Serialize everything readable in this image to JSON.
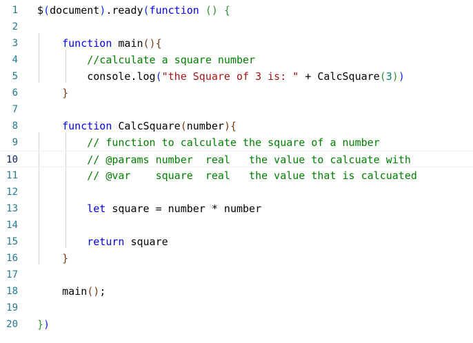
{
  "editor": {
    "current_line": 10,
    "lines": [
      {
        "n": "1",
        "tokens": [
          {
            "t": "$",
            "c": "tx"
          },
          {
            "t": "(",
            "c": "br1"
          },
          {
            "t": "document",
            "c": "tx"
          },
          {
            "t": ")",
            "c": "br1"
          },
          {
            "t": ".ready",
            "c": "tx"
          },
          {
            "t": "(",
            "c": "br1"
          },
          {
            "t": "function",
            "c": "kw"
          },
          {
            "t": " ",
            "c": "tx"
          },
          {
            "t": "()",
            "c": "br2"
          },
          {
            "t": " ",
            "c": "tx"
          },
          {
            "t": "{",
            "c": "br2"
          }
        ]
      },
      {
        "n": "2",
        "tokens": []
      },
      {
        "n": "3",
        "tokens": [
          {
            "t": "    ",
            "c": "tx"
          },
          {
            "t": "function",
            "c": "kw"
          },
          {
            "t": " main",
            "c": "tx"
          },
          {
            "t": "()",
            "c": "br3"
          },
          {
            "t": "{",
            "c": "br3"
          }
        ]
      },
      {
        "n": "4",
        "tokens": [
          {
            "t": "        ",
            "c": "tx"
          },
          {
            "t": "//calculate a square number",
            "c": "cm"
          }
        ]
      },
      {
        "n": "5",
        "tokens": [
          {
            "t": "        console.log",
            "c": "tx"
          },
          {
            "t": "(",
            "c": "br1"
          },
          {
            "t": "\"the Square of 3 is: \"",
            "c": "st"
          },
          {
            "t": " + CalcSquare",
            "c": "tx"
          },
          {
            "t": "(",
            "c": "br2"
          },
          {
            "t": "3",
            "c": "nm"
          },
          {
            "t": ")",
            "c": "br2"
          },
          {
            "t": ")",
            "c": "br1"
          }
        ]
      },
      {
        "n": "6",
        "tokens": [
          {
            "t": "    ",
            "c": "tx"
          },
          {
            "t": "}",
            "c": "br3"
          }
        ]
      },
      {
        "n": "7",
        "tokens": []
      },
      {
        "n": "8",
        "tokens": [
          {
            "t": "    ",
            "c": "tx"
          },
          {
            "t": "function",
            "c": "kw"
          },
          {
            "t": " CalcSquare",
            "c": "tx"
          },
          {
            "t": "(",
            "c": "br3"
          },
          {
            "t": "number",
            "c": "tx"
          },
          {
            "t": ")",
            "c": "br3"
          },
          {
            "t": "{",
            "c": "br3"
          }
        ]
      },
      {
        "n": "9",
        "tokens": [
          {
            "t": "        ",
            "c": "tx"
          },
          {
            "t": "// function to calculate the square of a number",
            "c": "cm"
          }
        ]
      },
      {
        "n": "10",
        "tokens": [
          {
            "t": "        ",
            "c": "tx"
          },
          {
            "t": "// @params number  real   the value to calcuate with",
            "c": "cm"
          }
        ]
      },
      {
        "n": "11",
        "tokens": [
          {
            "t": "        ",
            "c": "tx"
          },
          {
            "t": "// @var    square  real   the value that is calcuated",
            "c": "cm"
          }
        ]
      },
      {
        "n": "12",
        "tokens": []
      },
      {
        "n": "13",
        "tokens": [
          {
            "t": "        ",
            "c": "tx"
          },
          {
            "t": "let",
            "c": "kw"
          },
          {
            "t": " square = number * number",
            "c": "tx"
          }
        ]
      },
      {
        "n": "14",
        "tokens": []
      },
      {
        "n": "15",
        "tokens": [
          {
            "t": "        ",
            "c": "tx"
          },
          {
            "t": "return",
            "c": "kw"
          },
          {
            "t": " square",
            "c": "tx"
          }
        ]
      },
      {
        "n": "16",
        "tokens": [
          {
            "t": "    ",
            "c": "tx"
          },
          {
            "t": "}",
            "c": "br3"
          }
        ]
      },
      {
        "n": "17",
        "tokens": []
      },
      {
        "n": "18",
        "tokens": [
          {
            "t": "    main",
            "c": "tx"
          },
          {
            "t": "()",
            "c": "br3"
          },
          {
            "t": ";",
            "c": "tx"
          }
        ]
      },
      {
        "n": "19",
        "tokens": []
      },
      {
        "n": "20",
        "tokens": [
          {
            "t": "}",
            "c": "br2"
          },
          {
            "t": ")",
            "c": "br1"
          }
        ]
      }
    ]
  },
  "colors": {
    "keyword": "#0000ff",
    "comment": "#008000",
    "string": "#a31515",
    "number": "#098658",
    "line_number": "#237893",
    "bracket_level1": "#0431fa",
    "bracket_level2": "#319331",
    "bracket_level3": "#7b3814"
  }
}
